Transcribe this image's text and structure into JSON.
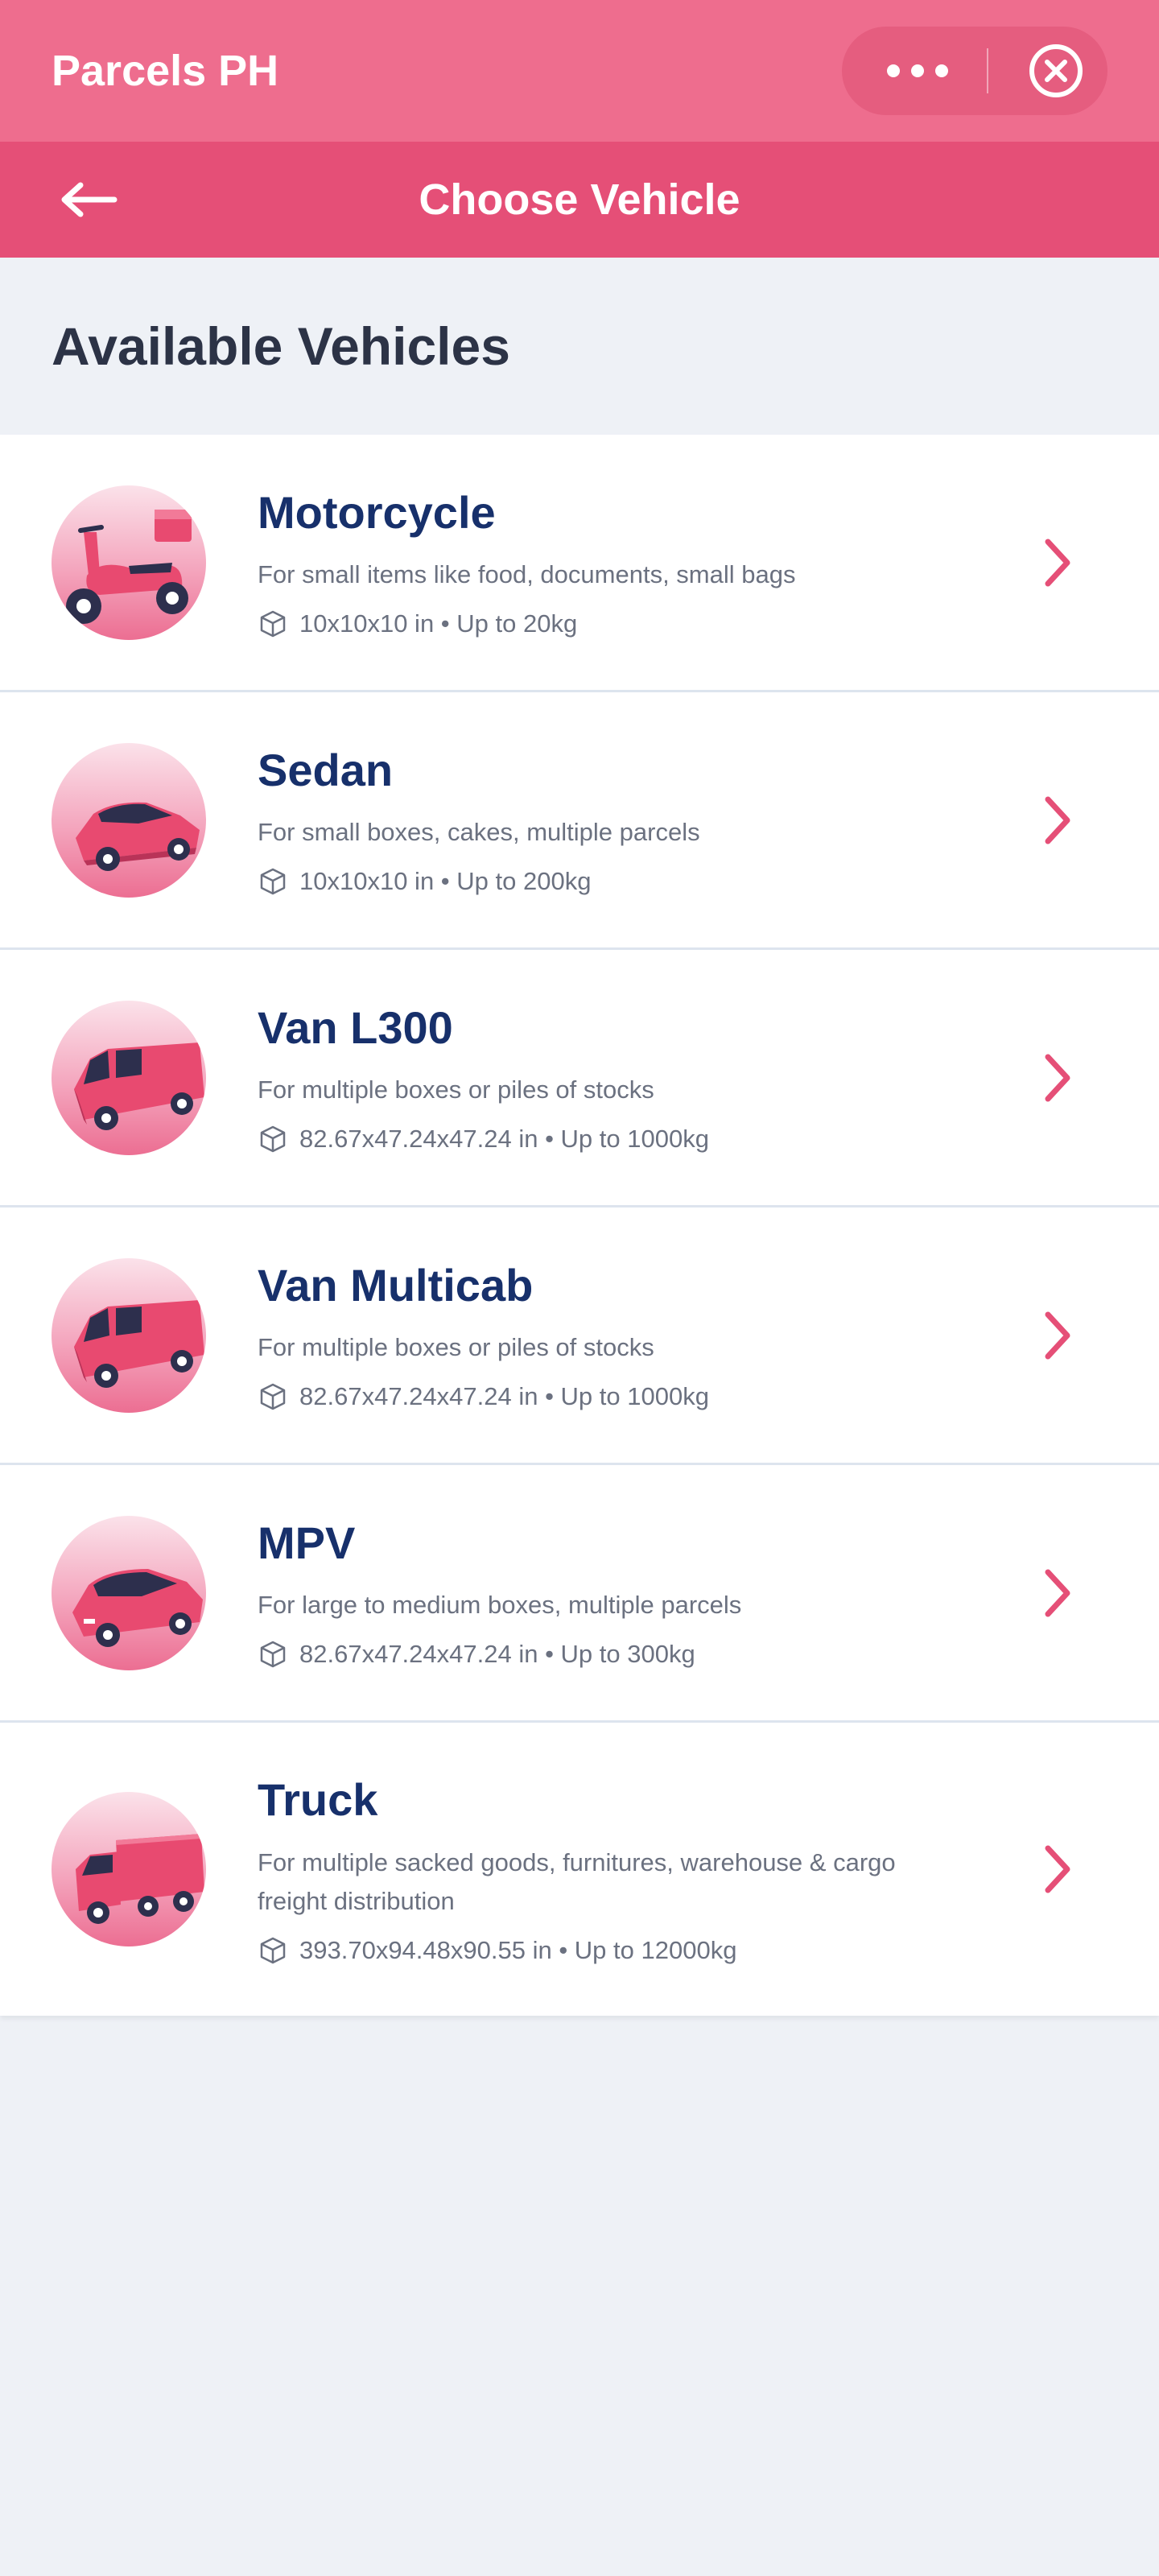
{
  "header": {
    "app_title": "Parcels PH"
  },
  "nav": {
    "title": "Choose Vehicle"
  },
  "section": {
    "title": "Available Vehicles"
  },
  "vehicles": [
    {
      "name": "Motorcycle",
      "description": "For small items like food, documents, small bags",
      "spec": "10x10x10 in • Up to 20kg",
      "icon": "motorcycle-icon"
    },
    {
      "name": "Sedan",
      "description": "For small boxes, cakes, multiple parcels",
      "spec": "10x10x10 in • Up to 200kg",
      "icon": "sedan-icon"
    },
    {
      "name": "Van L300",
      "description": "For multiple boxes or piles of stocks",
      "spec": "82.67x47.24x47.24 in • Up to 1000kg",
      "icon": "van-icon"
    },
    {
      "name": "Van Multicab",
      "description": "For multiple boxes or piles of stocks",
      "spec": "82.67x47.24x47.24 in • Up to 1000kg",
      "icon": "van-icon"
    },
    {
      "name": "MPV",
      "description": "For large to medium boxes, multiple parcels",
      "spec": "82.67x47.24x47.24 in • Up to 300kg",
      "icon": "mpv-icon"
    },
    {
      "name": "Truck",
      "description": "For multiple sacked goods, furnitures, warehouse & cargo freight distribution",
      "spec": "393.70x94.48x90.55 in • Up to 12000kg",
      "icon": "truck-icon"
    }
  ],
  "colors": {
    "header": "#ee6d8e",
    "nav": "#e54f77",
    "accent": "#e54f77",
    "title_text": "#17306b",
    "background": "#eef1f6"
  }
}
